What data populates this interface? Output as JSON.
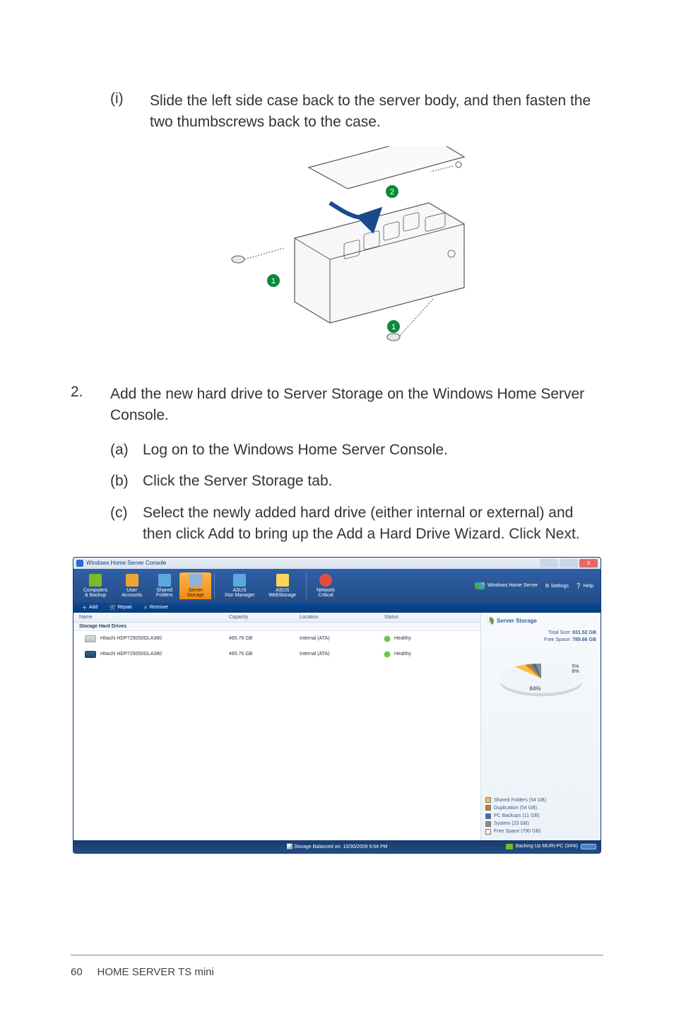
{
  "step_i": {
    "label": "(i)",
    "text": "Slide the left side case back to the server body, and then fasten the two thumbscrews back to the case."
  },
  "diagram": {
    "callout1": "1",
    "callout2": "2",
    "callout1b": "1"
  },
  "step_2": {
    "num": "2.",
    "text": "Add the new hard drive to Server Storage on the Windows Home Server Console."
  },
  "sub_a": {
    "label": "(a)",
    "text": "Log on to the Windows Home Server Console."
  },
  "sub_b": {
    "label": "(b)",
    "text": "Click the Server Storage tab."
  },
  "sub_c": {
    "label": "(c)",
    "text": "Select the newly added hard drive (either internal or external) and then click Add to bring up the Add a Hard Drive Wizard. Click Next."
  },
  "screenshot": {
    "window_title": "Windows Home Server Console",
    "brand": "Windows Home Server",
    "settings": "Settings",
    "help": "Help",
    "tabs": {
      "computers": "Computers\n& Backup",
      "users": "User\nAccounts",
      "shared": "Shared\nFolders",
      "storage": "Server\nStorage",
      "xtor": "ASUS\nXtor Manager",
      "webstorage": "ASUS\nWebStorage",
      "network": "Network\nCritical"
    },
    "subbar": {
      "add": "Add",
      "repair": "Repair",
      "remove": "Remove"
    },
    "headers": {
      "name": "Name",
      "capacity": "Capacity",
      "location": "Location",
      "status": "Status"
    },
    "group": "Storage Hard Drives",
    "drives": [
      {
        "name": "Hitachi HDP725050GLA380",
        "capacity": "465.76 GB",
        "location": "Internal (ATA)",
        "status": "Healthy"
      },
      {
        "name": "Hitachi HDP725050GLA380",
        "capacity": "465.76 GB",
        "location": "Internal (ATA)",
        "status": "Healthy"
      }
    ],
    "panel": {
      "title": "Server Storage",
      "total_label": "Total Size:",
      "total_value": "931.52 GB",
      "free_label": "Free Space:",
      "free_value": "789.66 GB",
      "pie_wedge_label": "5%\n6%",
      "pie_pct": "84%"
    },
    "legend": {
      "shared": "Shared Folders (54 GB)",
      "dup": "Duplication (54 GB)",
      "backups": "PC Backups (11 GB)",
      "system": "System (23 GB)",
      "free": "Free Space (790 GB)"
    },
    "statusbar": {
      "center": "Storage Balanced on: 10/30/2009 9:54 PM",
      "right": "Backing Up MURI-PC (34%)"
    }
  },
  "chart_data": {
    "type": "pie",
    "title": "Server Storage",
    "total_gb": 931.52,
    "values": [
      {
        "name": "Shared Folders",
        "gb": 54
      },
      {
        "name": "Duplication",
        "gb": 54
      },
      {
        "name": "PC Backups",
        "gb": 11
      },
      {
        "name": "System",
        "gb": 23
      },
      {
        "name": "Free Space",
        "gb": 790
      }
    ],
    "free_pct_label": 84
  },
  "footer": {
    "page": "60",
    "title": "HOME SERVER TS mini"
  }
}
